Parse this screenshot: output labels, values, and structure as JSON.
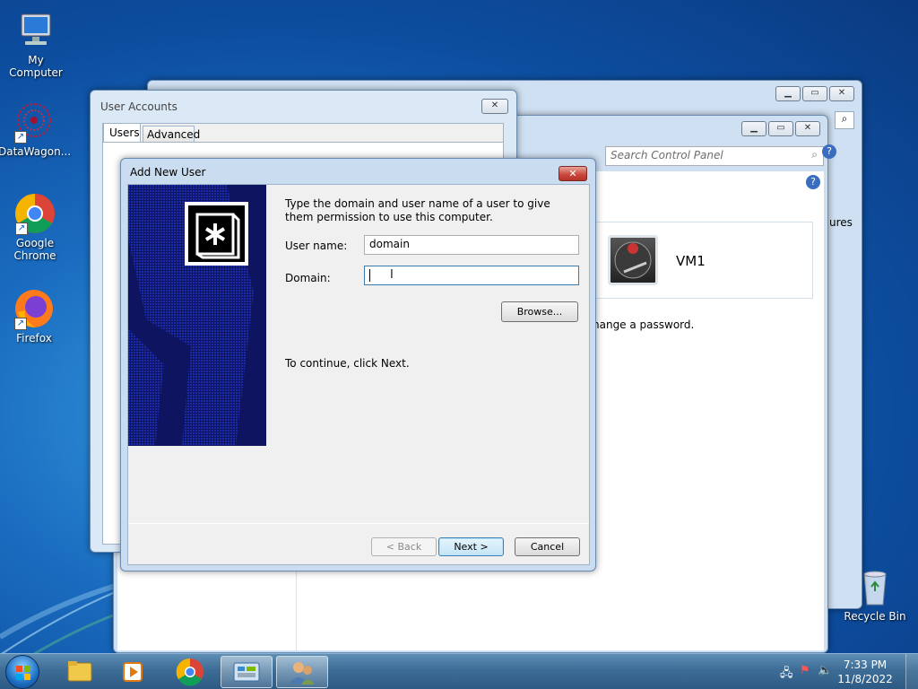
{
  "desktop": {
    "icons": [
      {
        "label": "My Computer"
      },
      {
        "label": "DataWagon..."
      },
      {
        "label": "Google Chrome"
      },
      {
        "label": "Firefox"
      },
      {
        "label": "Recycle Bin"
      }
    ]
  },
  "control_panel": {
    "search_placeholder": "Search Control Panel",
    "account_name": "VM1",
    "link_fragment": "hange a password.",
    "side_fragment": "ures"
  },
  "user_accounts": {
    "title": "User Accounts",
    "tabs": [
      {
        "label": "Users"
      },
      {
        "label": "Advanced"
      }
    ]
  },
  "dialog": {
    "title": "Add New User",
    "close_symbol": "✕",
    "instructions": "Type the domain and user name of a user to give them permission to use this computer.",
    "username_label": "User name:",
    "username_value": "domain",
    "domain_label": "Domain:",
    "domain_value": "",
    "browse_label": "Browse...",
    "continue_text": "To continue, click Next.",
    "back_label": "< Back",
    "next_label": "Next >",
    "cancel_label": "Cancel"
  },
  "taskbar": {
    "time": "7:33 PM",
    "date": "11/8/2022"
  },
  "colors": {
    "desktop": "#1a6cc0",
    "dialog_close": "#c9453a",
    "taskbar": "#3d6d96"
  }
}
